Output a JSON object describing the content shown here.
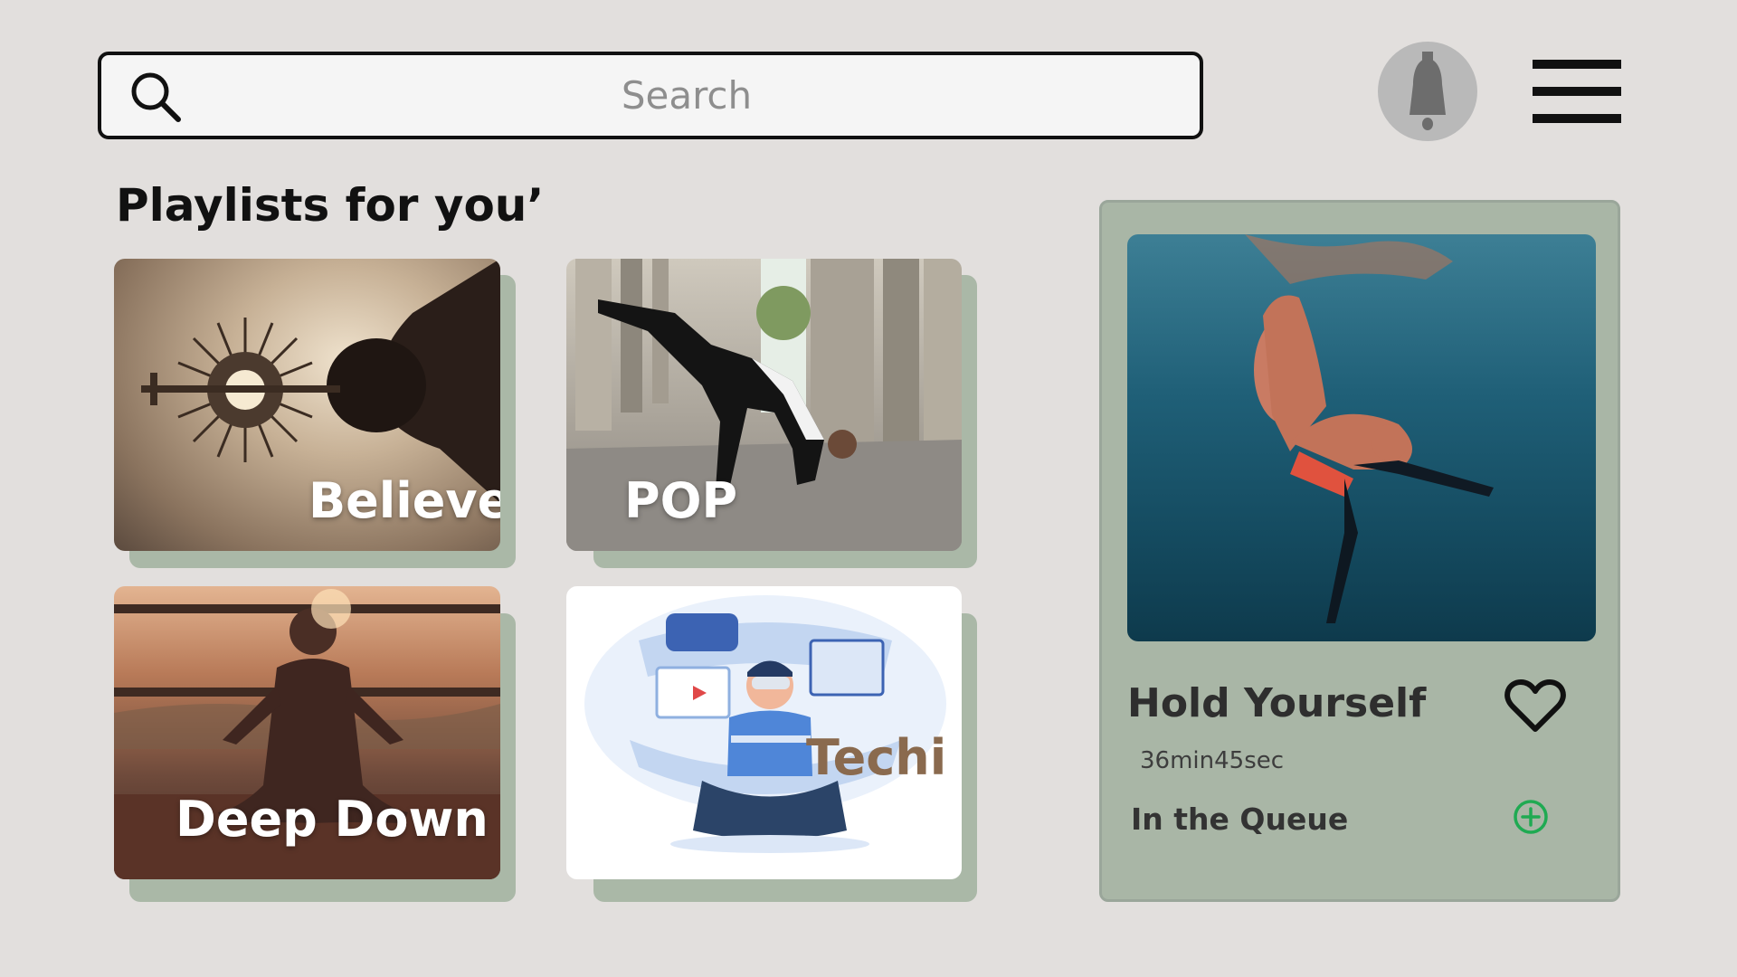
{
  "search": {
    "placeholder": "Search"
  },
  "header": {
    "notification_icon": "bell-icon",
    "menu_icon": "hamburger-menu-icon"
  },
  "section": {
    "title": "Playlists for you’"
  },
  "playlists": [
    {
      "label": "Believe",
      "image": "monstrance-photo"
    },
    {
      "label": "POP",
      "image": "breakdancer-photo"
    },
    {
      "label": "Deep Down",
      "image": "meditation-sunset-photo"
    },
    {
      "label": "Techi",
      "image": "vr-tech-illustration"
    }
  ],
  "now_playing": {
    "title": "Hold Yourself",
    "duration": "36min45sec",
    "queue_label": "In the Queue",
    "image": "underwater-swimmer-photo",
    "like_icon": "heart-icon",
    "add_icon": "plus-circle-icon"
  },
  "colors": {
    "background": "#e2dfdd",
    "card_shadow": "#aab8a7",
    "panel": "#a9b6a6",
    "add_accent": "#1faa52"
  }
}
